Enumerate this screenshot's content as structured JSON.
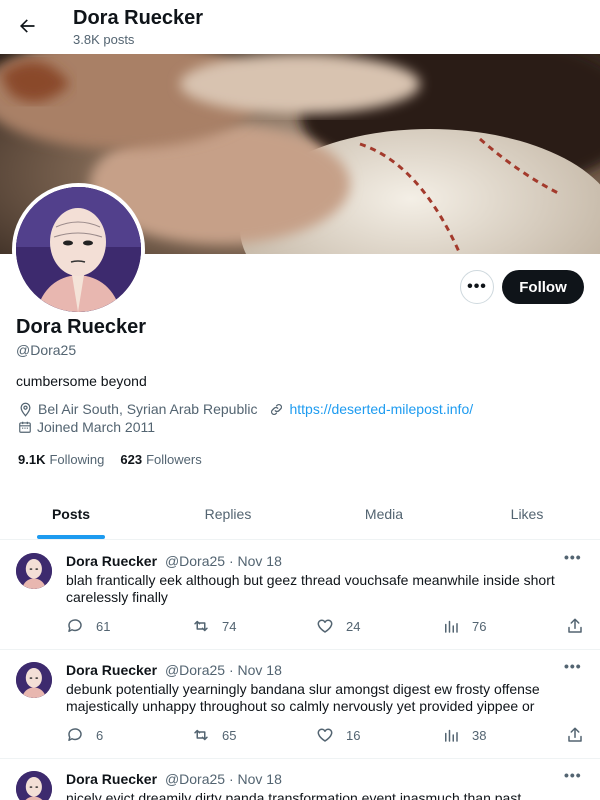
{
  "header": {
    "name": "Dora Ruecker",
    "posts_count": "3.8K posts"
  },
  "profile": {
    "display_name": "Dora Ruecker",
    "handle": "@Dora25",
    "bio": "cumbersome beyond",
    "location": "Bel Air South, Syrian Arab Republic",
    "website": "https://deserted-milepost.info/",
    "joined": "Joined March 2011",
    "following_count": "9.1K",
    "following_label": "Following",
    "followers_count": "623",
    "followers_label": "Followers",
    "follow_label": "Follow",
    "more_label": "•••"
  },
  "tabs": [
    {
      "label": "Posts",
      "active": true
    },
    {
      "label": "Replies",
      "active": false
    },
    {
      "label": "Media",
      "active": false
    },
    {
      "label": "Likes",
      "active": false
    }
  ],
  "posts": [
    {
      "name": "Dora Ruecker",
      "handle": "@Dora25",
      "date": "· Nov 18",
      "text": "blah frantically eek although but geez thread vouchsafe meanwhile inside short carelessly finally",
      "replies": "61",
      "reposts": "74",
      "likes": "24",
      "views": "76"
    },
    {
      "name": "Dora Ruecker",
      "handle": "@Dora25",
      "date": "· Nov 18",
      "text": "debunk potentially yearningly bandana slur amongst digest ew frosty offense majestically unhappy throughout so calmly nervously yet provided yippee or",
      "replies": "6",
      "reposts": "65",
      "likes": "16",
      "views": "38"
    },
    {
      "name": "Dora Ruecker",
      "handle": "@Dora25",
      "date": "· Nov 18",
      "text": "nicely evict dreamily dirty panda transformation event inasmuch than past",
      "replies": "",
      "reposts": "",
      "likes": "",
      "views": ""
    }
  ],
  "icons": {
    "back": "arrow-left-icon",
    "location": "map-pin-icon",
    "link": "link-icon",
    "calendar": "calendar-icon",
    "reply": "speech-bubble-icon",
    "repost": "repost-icon",
    "like": "heart-icon",
    "views": "bar-chart-icon",
    "share": "share-icon"
  },
  "colors": {
    "accent": "#1d9bf0",
    "text": "#0f1419",
    "muted": "#536471",
    "follow_bg": "#0f1419"
  }
}
